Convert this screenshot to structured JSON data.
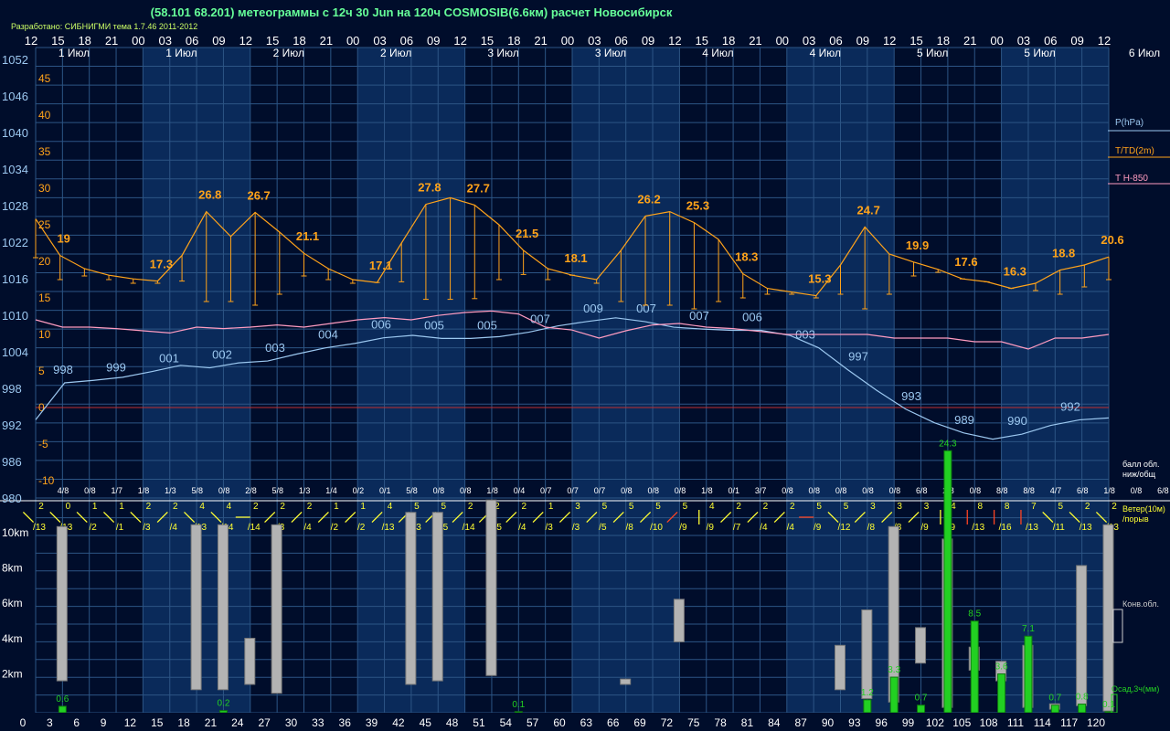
{
  "title": "(58.101 68.201) метеограммы с  12ч 30 Jun на 120ч COSMOSIB(6.6км) расчет Новосибирск",
  "developer": "Разработано: СИБНИГМИ тема 1.7.46 2011-2012",
  "colors": {
    "background": "#000d2b",
    "day_band": "#0a2a5a",
    "grid": "#2c5585",
    "pressure": "#9cc8f0",
    "temperature": "#ffa31a",
    "t850": "#ff9cc0",
    "precip": "#22d022",
    "cloud": "#b3b3b3",
    "wind_yellow": "#ffff33",
    "wind_red": "#ff4422",
    "zero_line": "#c03030"
  },
  "chart_data": {
    "type": "line",
    "top_hours": [
      "12",
      "15",
      "18",
      "21",
      "00",
      "03",
      "06",
      "09",
      "12",
      "15",
      "18",
      "21",
      "00",
      "03",
      "06",
      "09",
      "12",
      "15",
      "18",
      "21",
      "00",
      "03",
      "06",
      "09",
      "12",
      "15",
      "18",
      "21",
      "00",
      "03",
      "06",
      "09",
      "12",
      "15",
      "18",
      "21",
      "00",
      "03",
      "06",
      "09",
      "12"
    ],
    "day_labels": [
      "1 Июл",
      "1 Июл",
      "2 Июл",
      "2 Июл",
      "3 Июл",
      "3 Июл",
      "4 Июл",
      "4 Июл",
      "5 Июл",
      "5 Июл",
      "6 Июл"
    ],
    "lead_hours": [
      "0",
      "3",
      "6",
      "9",
      "12",
      "15",
      "18",
      "21",
      "24",
      "27",
      "30",
      "33",
      "36",
      "39",
      "42",
      "45",
      "48",
      "51",
      "54",
      "57",
      "60",
      "63",
      "66",
      "69",
      "72",
      "75",
      "78",
      "81",
      "84",
      "87",
      "90",
      "93",
      "96",
      "99",
      "102",
      "105",
      "108",
      "111",
      "114",
      "117",
      "120"
    ],
    "pressure_axis": [
      "1052",
      "1046",
      "1040",
      "1034",
      "1028",
      "1022",
      "1016",
      "1010",
      "1004",
      "998",
      "992",
      "986",
      "980"
    ],
    "temperature_axis": [
      "45",
      "40",
      "35",
      "30",
      "25",
      "20",
      "15",
      "10",
      "5",
      "0",
      "-5",
      "-10"
    ],
    "pressure": {
      "name": "P(hPa)",
      "values": [
        992.5,
        998.4,
        998.8,
        999.3,
        1000.2,
        1001.2,
        1000.8,
        1001.6,
        1001.9,
        1003.0,
        1004.0,
        1004.7,
        1005.6,
        1006.0,
        1005.5,
        1005.5,
        1005.8,
        1006.5,
        1007.5,
        1008.2,
        1008.8,
        1008.2,
        1007.3,
        1007.0,
        1006.8,
        1006.8,
        1006.0,
        1004.0,
        1000.5,
        997.2,
        994.2,
        992.0,
        990.4,
        989.4,
        990.2,
        991.6,
        992.5,
        992.8
      ],
      "labels": [
        {
          "h": 3,
          "text": "998"
        },
        {
          "h": 12,
          "text": "999"
        },
        {
          "h": 21,
          "text": "001"
        },
        {
          "h": 30,
          "text": "002"
        },
        {
          "h": 39,
          "text": "003"
        },
        {
          "h": 48,
          "text": "004"
        },
        {
          "h": 57,
          "text": "006"
        },
        {
          "h": 66,
          "text": "005"
        },
        {
          "h": 75,
          "text": "005"
        },
        {
          "h": 84,
          "text": "007"
        },
        {
          "h": 93,
          "text": "009"
        },
        {
          "h": 102,
          "text": "007"
        },
        {
          "h": 111,
          "text": "007"
        },
        {
          "h": 118,
          "text": "006"
        },
        {
          "h": 129,
          "text": "003"
        },
        {
          "h": 138,
          "text": "997"
        },
        {
          "h": 147,
          "text": "993"
        },
        {
          "h": 156,
          "text": "989"
        },
        {
          "h": 165,
          "text": "990"
        },
        {
          "h": 174,
          "text": "992"
        }
      ]
    },
    "temperature": {
      "name": "T/TD(2m)",
      "values": [
        25.8,
        20.8,
        19.0,
        18.1,
        17.6,
        17.3,
        20.8,
        26.8,
        23.4,
        26.7,
        24.0,
        21.1,
        19.0,
        17.5,
        17.1,
        22.5,
        27.8,
        28.7,
        27.7,
        25.0,
        21.5,
        19.0,
        18.1,
        17.5,
        21.5,
        26.2,
        26.8,
        25.3,
        23.0,
        18.3,
        16.3,
        15.8,
        15.3,
        19.5,
        24.7,
        21.0,
        19.9,
        18.9,
        17.6,
        17.2,
        16.3,
        17.0,
        18.8,
        19.5,
        20.6
      ],
      "dew_values": [
        20.5,
        17.5,
        18.0,
        17.5,
        17.0,
        17.0,
        17.3,
        14.5,
        14.5,
        14.0,
        15.5,
        18.0,
        17.5,
        17.0,
        17.1,
        17.2,
        14.8,
        14.8,
        14.9,
        17.5,
        18.2,
        17.5,
        18.1,
        17.0,
        14.5,
        14.0,
        14.0,
        13.5,
        14.5,
        15.0,
        15.5,
        15.5,
        15.0,
        15.5,
        13.5,
        15.5,
        18.0,
        18.5,
        17.6,
        17.2,
        16.3,
        16.0,
        15.5,
        16.5,
        17.5
      ],
      "labels": [
        {
          "i": 1,
          "text": "19"
        },
        {
          "i": 5,
          "text": "17.3"
        },
        {
          "i": 7,
          "text": "26.8"
        },
        {
          "i": 9,
          "text": "26.7"
        },
        {
          "i": 11,
          "text": "21.1"
        },
        {
          "i": 14,
          "text": "17.1"
        },
        {
          "i": 16,
          "text": "27.8"
        },
        {
          "i": 18,
          "text": "27.7"
        },
        {
          "i": 20,
          "text": "21.5"
        },
        {
          "i": 22,
          "text": "18.1"
        },
        {
          "i": 25,
          "text": "26.2"
        },
        {
          "i": 27,
          "text": "25.3"
        },
        {
          "i": 29,
          "text": "18.3"
        },
        {
          "i": 32,
          "text": "15.3"
        },
        {
          "i": 34,
          "text": "24.7"
        },
        {
          "i": 36,
          "text": "19.9"
        },
        {
          "i": 38,
          "text": "17.6"
        },
        {
          "i": 40,
          "text": "16.3"
        },
        {
          "i": 42,
          "text": "18.8"
        },
        {
          "i": 44,
          "text": "20.6"
        }
      ]
    },
    "t850": {
      "name": "T H-850",
      "values": [
        12.0,
        11.0,
        11.0,
        10.8,
        10.5,
        10.2,
        11.0,
        10.8,
        11.0,
        11.3,
        11.0,
        11.5,
        12.0,
        12.3,
        12.0,
        12.6,
        13.0,
        13.2,
        12.8,
        11.0,
        10.6,
        9.5,
        10.5,
        11.3,
        11.5,
        11.0,
        10.8,
        10.4,
        10.0,
        10.0,
        10.0,
        10.0,
        9.5,
        9.5,
        9.5,
        9.0,
        9.0,
        8.0,
        9.5,
        9.5,
        10.0
      ]
    },
    "cloud_fraction": [
      "4/8",
      "0/8",
      "1/7",
      "1/8",
      "1/3",
      "5/8",
      "0/8",
      "2/8",
      "5/8",
      "1/3",
      "1/4",
      "0/2",
      "0/1",
      "5/8",
      "0/8",
      "0/8",
      "1/8",
      "0/4",
      "0/7",
      "0/7",
      "0/7",
      "0/8",
      "0/8",
      "0/8",
      "1/8",
      "0/1",
      "3/7",
      "0/8",
      "0/8",
      "0/8",
      "0/8",
      "0/8",
      "6/8",
      "2/8",
      "0/8",
      "8/8",
      "8/8",
      "4/7",
      "6/8",
      "1/8",
      "0/8",
      "6/8"
    ],
    "wind": {
      "header": "Ветер(10м)",
      "subheader": "/порыв",
      "cloud_header_line1": "балл обл.",
      "cloud_header_line2": "ниж/общ",
      "items": [
        {
          "s": "2",
          "g": "/13",
          "d": "se",
          "c": "y"
        },
        {
          "s": "0",
          "g": "/13",
          "d": "se",
          "c": "y"
        },
        {
          "s": "1",
          "g": "/2",
          "d": "se",
          "c": "y"
        },
        {
          "s": "1",
          "g": "/1",
          "d": "se",
          "c": "y"
        },
        {
          "s": "2",
          "g": "/3",
          "d": "se",
          "c": "y"
        },
        {
          "s": "2",
          "g": "/4",
          "d": "ne",
          "c": "y"
        },
        {
          "s": "4",
          "g": "/13",
          "d": "se",
          "c": "y"
        },
        {
          "s": "4",
          "g": "/14",
          "d": "se",
          "c": "y"
        },
        {
          "s": "2",
          "g": "/14",
          "d": "e",
          "c": "y"
        },
        {
          "s": "2",
          "g": "/3",
          "d": "ne",
          "c": "y"
        },
        {
          "s": "2",
          "g": "/4",
          "d": "ne",
          "c": "y"
        },
        {
          "s": "1",
          "g": "/2",
          "d": "ne",
          "c": "y"
        },
        {
          "s": "1",
          "g": "/2",
          "d": "ne",
          "c": "y"
        },
        {
          "s": "4",
          "g": "/13",
          "d": "ne",
          "c": "y"
        },
        {
          "s": "5",
          "g": "/13",
          "d": "ne",
          "c": "y"
        },
        {
          "s": "5",
          "g": "/15",
          "d": "ne",
          "c": "y"
        },
        {
          "s": "2",
          "g": "/14",
          "d": "ne",
          "c": "y"
        },
        {
          "s": "2",
          "g": "/15",
          "d": "ne",
          "c": "y"
        },
        {
          "s": "2",
          "g": "/4",
          "d": "ne",
          "c": "y"
        },
        {
          "s": "1",
          "g": "/3",
          "d": "ne",
          "c": "y"
        },
        {
          "s": "3",
          "g": "/3",
          "d": "ne",
          "c": "y"
        },
        {
          "s": "5",
          "g": "/5",
          "d": "ne",
          "c": "y"
        },
        {
          "s": "5",
          "g": "/8",
          "d": "ne",
          "c": "y"
        },
        {
          "s": "5",
          "g": "/10",
          "d": "ne",
          "c": "y"
        },
        {
          "s": "5",
          "g": "/9",
          "d": "ne",
          "c": "r"
        },
        {
          "s": "4",
          "g": "/9",
          "d": "n",
          "c": "y"
        },
        {
          "s": "2",
          "g": "/7",
          "d": "ne",
          "c": "y"
        },
        {
          "s": "2",
          "g": "/4",
          "d": "ne",
          "c": "y"
        },
        {
          "s": "2",
          "g": "/4",
          "d": "ne",
          "c": "y"
        },
        {
          "s": "5",
          "g": "/9",
          "d": "w",
          "c": "r"
        },
        {
          "s": "5",
          "g": "/12",
          "d": "se",
          "c": "y"
        },
        {
          "s": "3",
          "g": "/8",
          "d": "sw",
          "c": "y"
        },
        {
          "s": "3",
          "g": "/8",
          "d": "sw",
          "c": "y"
        },
        {
          "s": "3",
          "g": "/9",
          "d": "sw",
          "c": "y"
        },
        {
          "s": "4",
          "g": "/9",
          "d": "s",
          "c": "y"
        },
        {
          "s": "8",
          "g": "/13",
          "d": "s",
          "c": "r"
        },
        {
          "s": "8",
          "g": "/16",
          "d": "s",
          "c": "r"
        },
        {
          "s": "7",
          "g": "/13",
          "d": "s",
          "c": "r"
        },
        {
          "s": "5",
          "g": "/11",
          "d": "se",
          "c": "y"
        },
        {
          "s": "2",
          "g": "/13",
          "d": "se",
          "c": "y"
        },
        {
          "s": "2",
          "g": "/13",
          "d": "se",
          "c": "y"
        }
      ]
    },
    "height_axis": [
      "10km",
      "8km",
      "6km",
      "4km",
      "2km"
    ],
    "convective_clouds": {
      "name": "Конв.обл.",
      "items": [
        {
          "h": 3,
          "base": 1.8,
          "top": 10.5
        },
        {
          "h": 18,
          "base": 1.3,
          "top": 10.6
        },
        {
          "h": 21,
          "base": 1.3,
          "top": 10.6
        },
        {
          "h": 24,
          "base": 1.6,
          "top": 4.2
        },
        {
          "h": 27,
          "base": 1.1,
          "top": 10.6
        },
        {
          "h": 42,
          "base": 1.6,
          "top": 11.3
        },
        {
          "h": 45,
          "base": 1.8,
          "top": 11.3
        },
        {
          "h": 51,
          "base": 2.1,
          "top": 12.0
        },
        {
          "h": 66,
          "base": 1.6,
          "top": 1.9
        },
        {
          "h": 72,
          "base": 4.0,
          "top": 6.4
        },
        {
          "h": 90,
          "base": 1.3,
          "top": 3.8
        },
        {
          "h": 93,
          "base": 0.8,
          "top": 5.8
        },
        {
          "h": 96,
          "base": 0.6,
          "top": 10.5
        },
        {
          "h": 99,
          "base": 2.8,
          "top": 4.8
        },
        {
          "h": 102,
          "base": 0.3,
          "top": 9.8
        },
        {
          "h": 105,
          "base": 2.4,
          "top": 3.7
        },
        {
          "h": 108,
          "base": 1.8,
          "top": 2.9
        },
        {
          "h": 111,
          "base": 0.3,
          "top": 3.8
        },
        {
          "h": 114,
          "base": 0.2,
          "top": 0.5
        },
        {
          "h": 117,
          "base": 0.4,
          "top": 8.3
        },
        {
          "h": 120,
          "base": 0.1,
          "top": 10.6
        }
      ]
    },
    "precipitation": {
      "name": "Осад,3ч(мм)",
      "items": [
        {
          "h": 3,
          "v": 0.6,
          "label": "0.6"
        },
        {
          "h": 21,
          "v": 0.2,
          "label": "0.2"
        },
        {
          "h": 54,
          "v": 0.1,
          "label": "0.1"
        },
        {
          "h": 93,
          "v": 1.2,
          "label": "1.2"
        },
        {
          "h": 96,
          "v": 3.3,
          "label": "3.3"
        },
        {
          "h": 99,
          "v": 0.7,
          "label": "0.7"
        },
        {
          "h": 102,
          "v": 24.3,
          "label": "24.3"
        },
        {
          "h": 105,
          "v": 8.5,
          "label": "8.5"
        },
        {
          "h": 108,
          "v": 3.6,
          "label": "3.6"
        },
        {
          "h": 111,
          "v": 7.1,
          "label": "7.1"
        },
        {
          "h": 114,
          "v": 0.7,
          "label": "0.7"
        },
        {
          "h": 117,
          "v": 0.8,
          "label": "0.8"
        },
        {
          "h": 120,
          "v": 0.1,
          "label": "0.1"
        }
      ]
    }
  }
}
